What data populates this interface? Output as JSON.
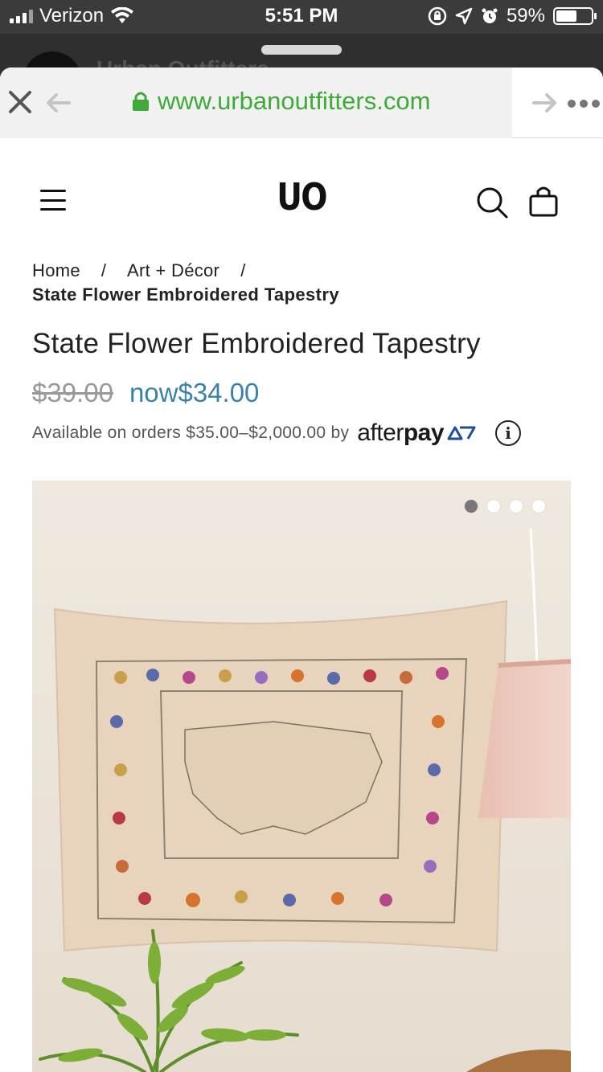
{
  "status_bar": {
    "carrier": "Verizon",
    "time": "5:51 PM",
    "battery": "59%",
    "battery_level": 0.59
  },
  "background_app": {
    "title": "Urban Outfitters"
  },
  "browser": {
    "url": "www.urbanoutfitters.com",
    "url_color": "#3faa3a"
  },
  "header": {
    "logo": "UO"
  },
  "breadcrumb": {
    "home": "Home",
    "category": "Art + Décor",
    "separator": "/",
    "current": "State Flower Embroidered Tapestry"
  },
  "product": {
    "title": "State Flower Embroidered Tapestry",
    "old_price": "$39.00",
    "now_price": "now$34.00",
    "price_color": "#3a82a8",
    "afterpay_text": "Available on orders $35.00–$2,000.00 by",
    "afterpay_logo_light": "after",
    "afterpay_logo_bold": "pay",
    "image_dots": 4,
    "active_dot": 1
  },
  "icons": [
    "close-icon",
    "back-arrow-icon",
    "lock-icon",
    "forward-arrow-icon",
    "more-icon",
    "menu-icon",
    "search-icon",
    "bag-icon",
    "info-icon",
    "wifi-icon",
    "location-icon",
    "alarm-icon",
    "rotation-lock-icon"
  ]
}
